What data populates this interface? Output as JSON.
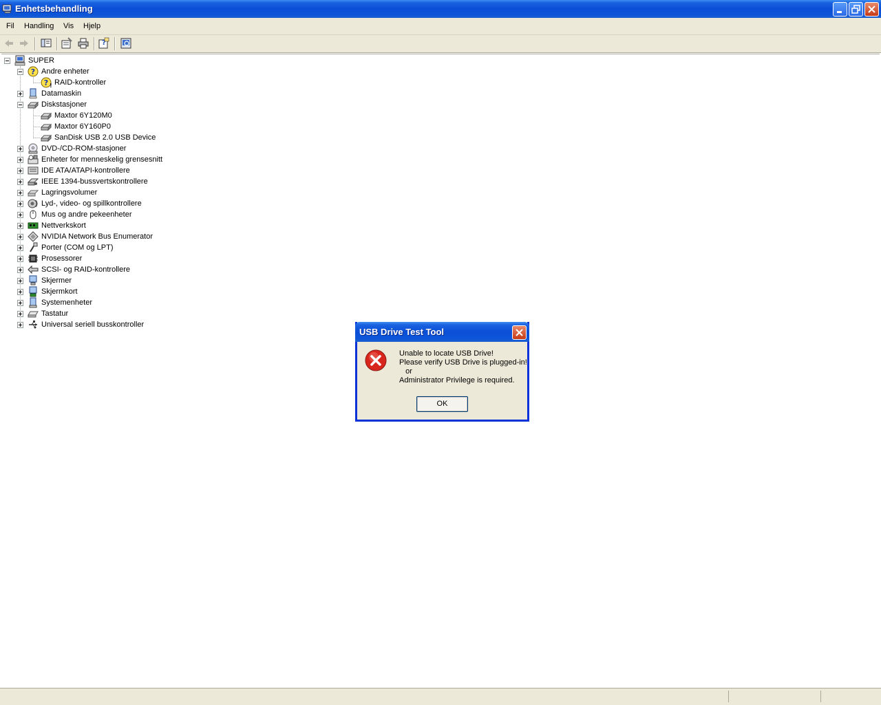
{
  "window": {
    "title": "Enhetsbehandling"
  },
  "menu": {
    "items": [
      {
        "label": "Fil"
      },
      {
        "label": "Handling"
      },
      {
        "label": "Vis"
      },
      {
        "label": "Hjelp"
      }
    ]
  },
  "toolbar": {
    "buttons": [
      "back-icon",
      "forward-icon",
      "console-tree-icon",
      "properties-icon",
      "print-icon",
      "help-icon",
      "scan-hardware-icon"
    ]
  },
  "tree": {
    "root": {
      "label": "SUPER",
      "icon": "computer-icon",
      "expanded": true
    },
    "nodes": [
      {
        "label": "Andre enheter",
        "icon": "unknown-device-icon",
        "expanded": true,
        "children": [
          {
            "label": "RAID-kontroller",
            "icon": "unknown-device-warning-icon"
          }
        ]
      },
      {
        "label": "Datamaskin",
        "icon": "computer-icon",
        "expanded": false
      },
      {
        "label": "Diskstasjoner",
        "icon": "disk-drive-icon",
        "expanded": true,
        "children": [
          {
            "label": "Maxtor 6Y120M0",
            "icon": "disk-drive-icon"
          },
          {
            "label": "Maxtor 6Y160P0",
            "icon": "disk-drive-icon"
          },
          {
            "label": "SanDisk USB 2.0 USB Device",
            "icon": "disk-drive-icon"
          }
        ]
      },
      {
        "label": "DVD-/CD-ROM-stasjoner",
        "icon": "cdrom-icon",
        "expanded": false
      },
      {
        "label": "Enheter for menneskelig grensesnitt",
        "icon": "hid-icon",
        "expanded": false
      },
      {
        "label": "IDE ATA/ATAPI-kontrollere",
        "icon": "ide-controller-icon",
        "expanded": false
      },
      {
        "label": "IEEE 1394-bussvertskontrollere",
        "icon": "firewire-icon",
        "expanded": false
      },
      {
        "label": "Lagringsvolumer",
        "icon": "storage-volume-icon",
        "expanded": false
      },
      {
        "label": "Lyd-, video- og spillkontrollere",
        "icon": "sound-icon",
        "expanded": false
      },
      {
        "label": "Mus og andre pekeenheter",
        "icon": "mouse-icon",
        "expanded": false
      },
      {
        "label": "Nettverkskort",
        "icon": "network-card-icon",
        "expanded": false
      },
      {
        "label": "NVIDIA Network Bus Enumerator",
        "icon": "nvidia-bus-icon",
        "expanded": false
      },
      {
        "label": "Porter (COM og LPT)",
        "icon": "port-icon",
        "expanded": false
      },
      {
        "label": "Prosessorer",
        "icon": "processor-icon",
        "expanded": false
      },
      {
        "label": "SCSI- og RAID-kontrollere",
        "icon": "scsi-icon",
        "expanded": false
      },
      {
        "label": "Skjermer",
        "icon": "monitor-icon",
        "expanded": false
      },
      {
        "label": "Skjermkort",
        "icon": "display-adapter-icon",
        "expanded": false
      },
      {
        "label": "Systemenheter",
        "icon": "system-device-icon",
        "expanded": false
      },
      {
        "label": "Tastatur",
        "icon": "keyboard-icon",
        "expanded": false
      },
      {
        "label": "Universal seriell busskontroller",
        "icon": "usb-icon",
        "expanded": false
      }
    ]
  },
  "dialog": {
    "title": "USB Drive Test Tool",
    "message": "Unable to locate USB Drive!\nPlease verify USB Drive is plugged-in!\n   or\nAdministrator Privilege is required.",
    "ok_label": "OK",
    "icon": "error-icon"
  },
  "colors": {
    "titlebar": "#0a4fd6",
    "chrome": "#ece9d8",
    "error_red": "#d9261c"
  }
}
